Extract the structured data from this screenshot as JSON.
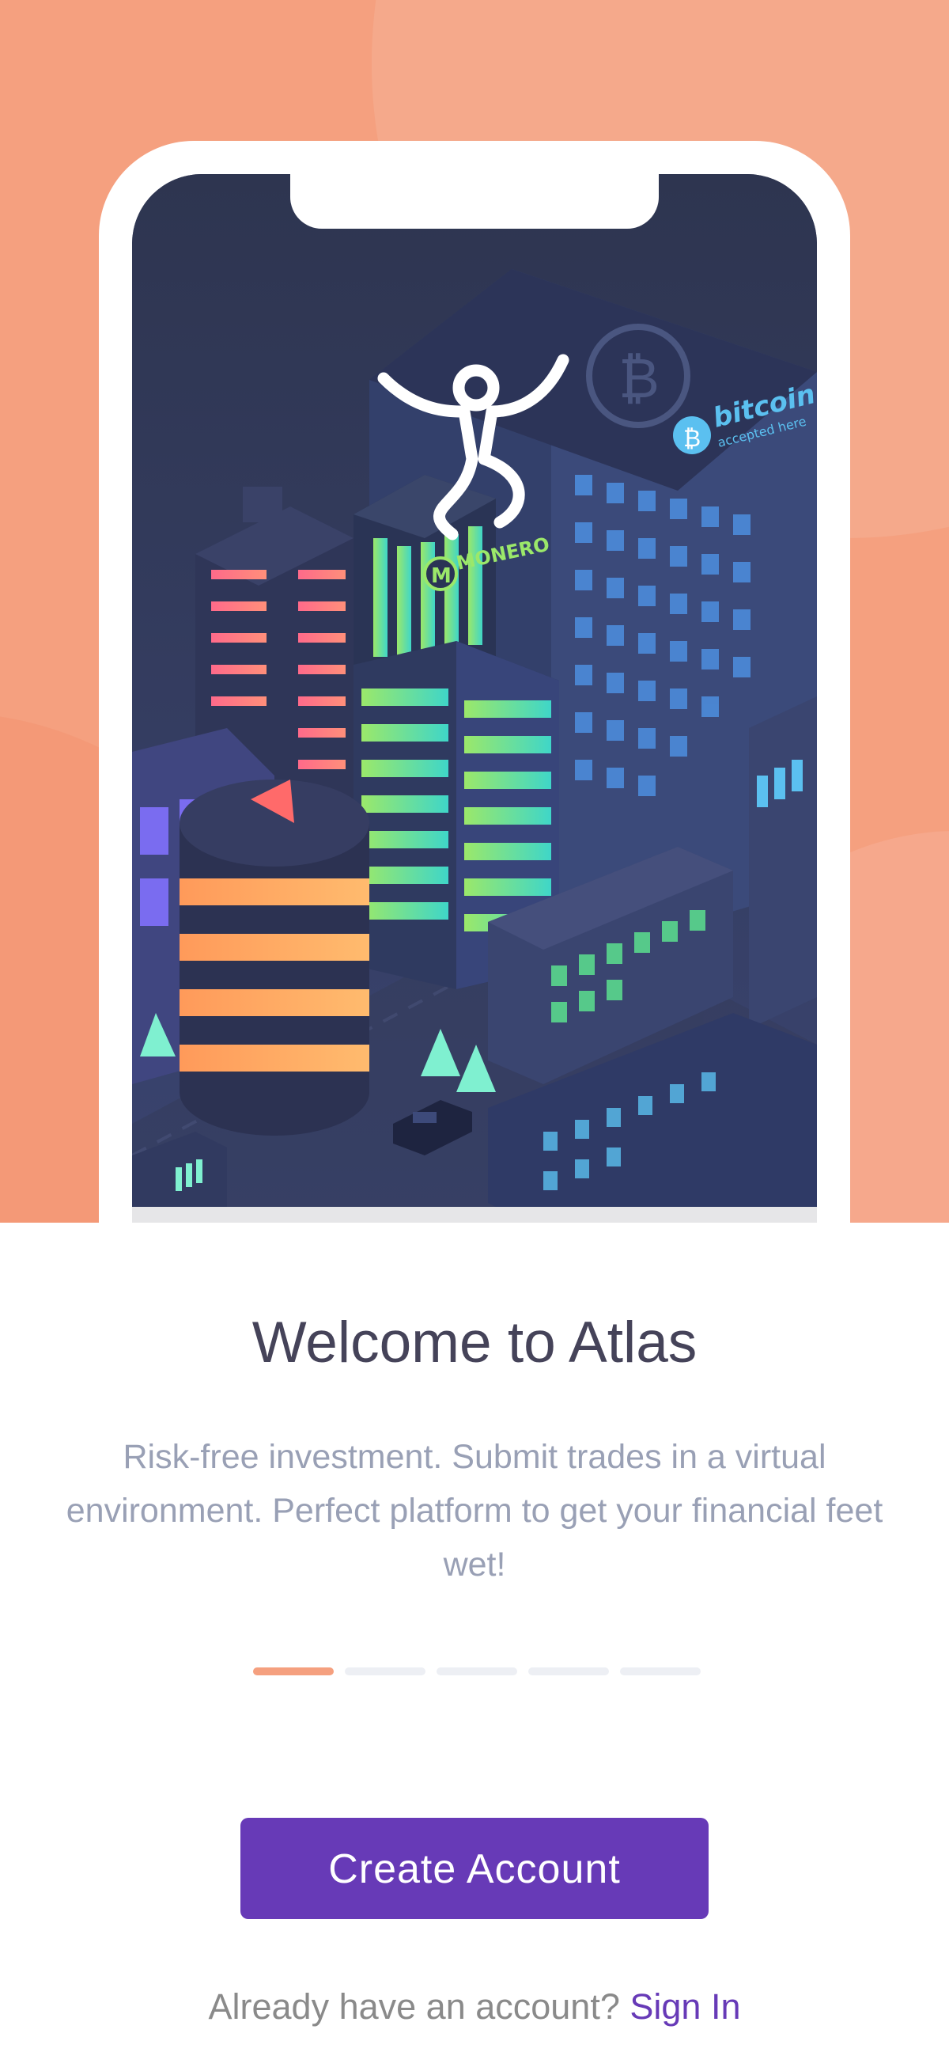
{
  "onboarding": {
    "title": "Welcome to Atlas",
    "description": "Risk-free investment. Submit trades in a virtual environment. Perfect platform to get your financial feet wet!",
    "page_indicator": {
      "total": 5,
      "current": 1
    },
    "illustration_signs": {
      "monero": "MONERO",
      "bitcoin": "bitcoin",
      "bitcoin_sub": "accepted here"
    }
  },
  "actions": {
    "create_account": "Create Account",
    "signin_prompt": "Already have an account?",
    "signin_link": "Sign In"
  },
  "colors": {
    "hero_bg": "#f5a07f",
    "primary": "#673ab7",
    "title": "#454359",
    "description": "#99a0b5",
    "dot_active": "#f5a07f",
    "dot_inactive": "#edeff4"
  }
}
